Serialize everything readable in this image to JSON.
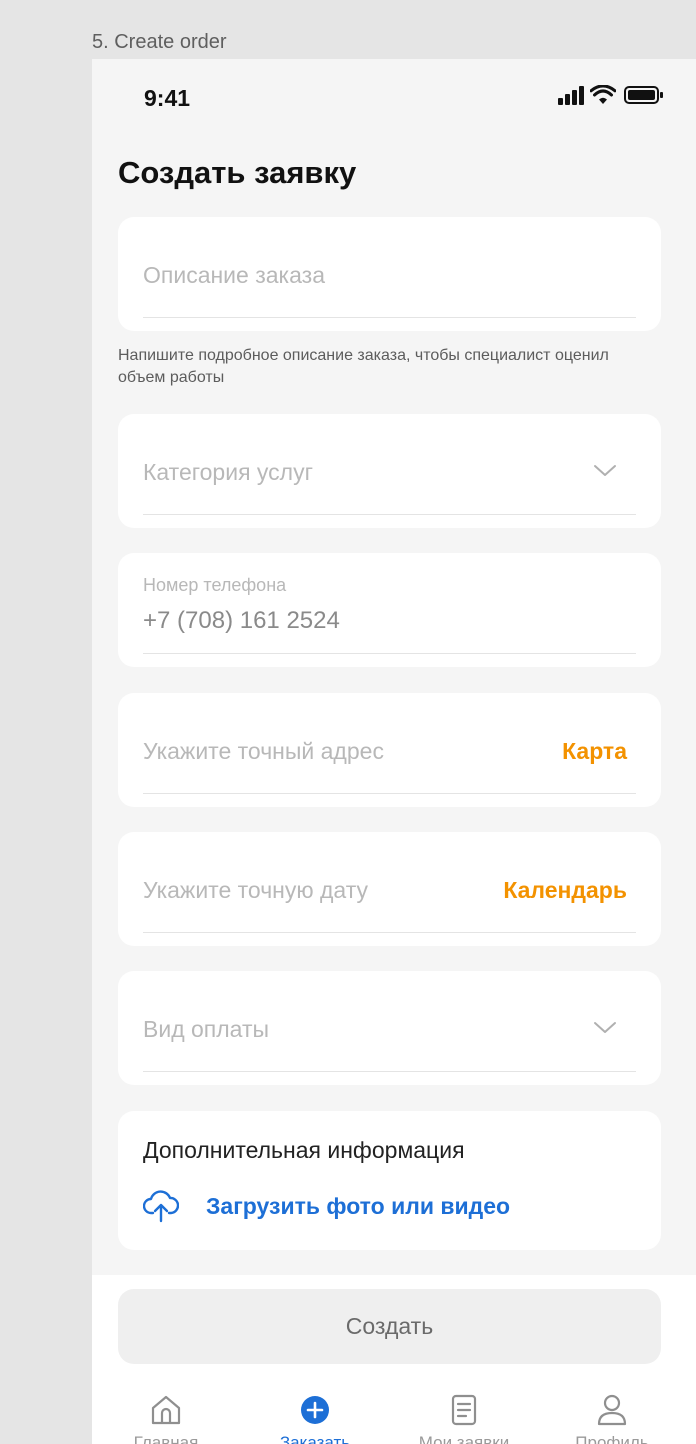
{
  "frame_label": "5. Create order",
  "status_bar": {
    "time": "9:41"
  },
  "page_title": "Создать заявку",
  "form": {
    "description_placeholder": "Описание заказа",
    "description_hint": "Напишите подробное описание заказа, чтобы специалист оценил объем работы",
    "category_placeholder": "Категория услуг",
    "phone_label": "Номер телефона",
    "phone_value": "+7 (708) 161 2524",
    "address_placeholder": "Укажите точный адрес",
    "address_action": "Карта",
    "date_placeholder": "Укажите точную дату",
    "date_action": "Календарь",
    "payment_placeholder": "Вид оплаты",
    "extra_info_title": "Дополнительная информация",
    "upload_label": "Загрузить фото или видео"
  },
  "create_button_label": "Создать",
  "tab_bar": {
    "active": "Заказать",
    "items": [
      {
        "label": "Главная",
        "icon": "home-icon"
      },
      {
        "label": "Заказать",
        "icon": "plus-circle-icon"
      },
      {
        "label": "Мои заявки",
        "icon": "document-icon"
      },
      {
        "label": "Профиль",
        "icon": "user-icon"
      }
    ]
  },
  "colors": {
    "accent_orange": "#f39200",
    "accent_blue": "#1d6fd6",
    "background": "#f5f5f5",
    "card": "#ffffff"
  }
}
